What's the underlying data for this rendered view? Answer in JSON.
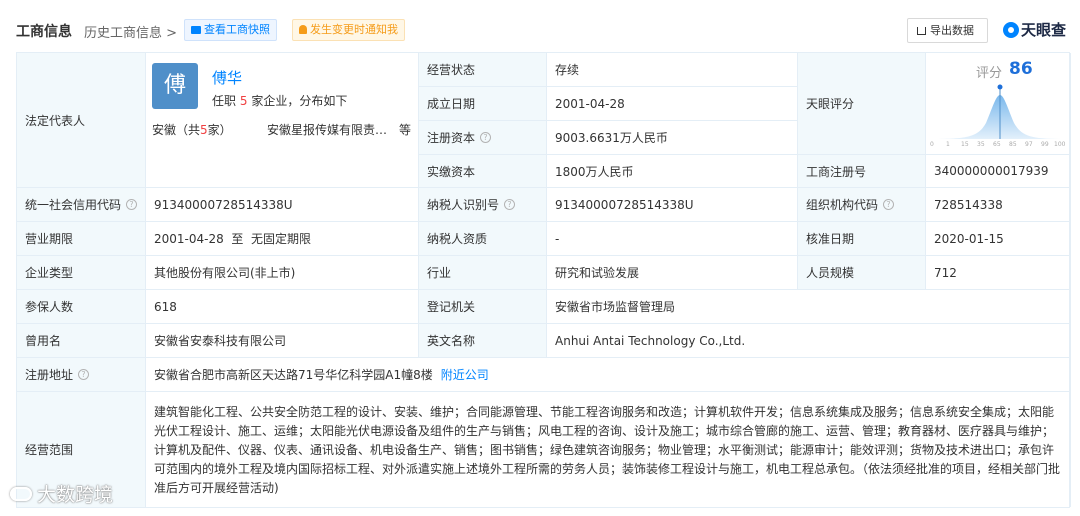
{
  "header": {
    "title": "工商信息",
    "history": "历史工商信息",
    "history_arrow": ">",
    "snapshot_button": "查看工商快照",
    "notify_button": "发生变更时通知我",
    "export_button": "导出数据",
    "logo": "天眼查"
  },
  "rep": {
    "label": "法定代表人",
    "avatar_char": "傅",
    "name": "傅华",
    "sub_prefix": "任职",
    "sub_count": "5",
    "sub_suffix": "家企业，分布如下",
    "prov_prefix": "安徽（共",
    "prov_count": "5",
    "prov_suffix": "家）",
    "company": "安徽星报传媒有限责…",
    "more": "等"
  },
  "rows": {
    "status_label": "经营状态",
    "status": "存续",
    "est_label": "成立日期",
    "est": "2001-04-28",
    "capital_label": "注册资本",
    "capital": "9003.6631万人民币",
    "paid_label": "实缴资本",
    "paid": "1800万人民币",
    "score_label": "天眼评分",
    "regno_label": "工商注册号",
    "regno": "340000000017939",
    "credit_label": "统一社会信用代码",
    "credit": "91340000728514338U",
    "taxid_label": "纳税人识别号",
    "taxid": "91340000728514338U",
    "org_label": "组织机构代码",
    "org": "728514338",
    "term_label": "营业期限",
    "term": "2001-04-28  至  无固定期限",
    "taxq_label": "纳税人资质",
    "taxq": "-",
    "approve_label": "核准日期",
    "approve": "2020-01-15",
    "type_label": "企业类型",
    "type": "其他股份有限公司(非上市)",
    "industry_label": "行业",
    "industry": "研究和试验发展",
    "staff_label": "人员规模",
    "staff": "712",
    "insured_label": "参保人数",
    "insured": "618",
    "authority_label": "登记机关",
    "authority": "安徽省市场监督管理局",
    "former_label": "曾用名",
    "former": "安徽省安泰科技有限公司",
    "en_label": "英文名称",
    "en": "Anhui Antai Technology Co.,Ltd.",
    "addr_label": "注册地址",
    "addr": "安徽省合肥市高新区天达路71号华亿科学园A1幢8楼",
    "addr_link": "附近公司",
    "scope_label": "经营范围",
    "scope": "建筑智能化工程、公共安全防范工程的设计、安装、维护；合同能源管理、节能工程咨询服务和改造；计算机软件开发；信息系统集成及服务；信息系统安全集成；太阳能光伏工程设计、施工、运维；太阳能光伏电源设备及组件的生产与销售；风电工程的咨询、设计及施工；城市综合管廊的施工、运营、管理；教育器材、医疗器具与维护；计算机及配件、仪器、仪表、通讯设备、机电设备生产、销售；图书销售；绿色建筑咨询服务；物业管理；水平衡测试；能源审计；能效评测；货物及技术进出口；承包许可范围内的境外工程及境内国际招标工程、对外派遣实施上述境外工程所需的劳务人员；装饰装修工程设计与施工，机电工程总承包。（依法须经批准的项目，经相关部门批准后方可开展经营活动)"
  },
  "score": {
    "label": "评分",
    "value": "86",
    "ticks": [
      "0",
      "1",
      "15",
      "35",
      "65",
      "85",
      "97",
      "99",
      "100"
    ]
  },
  "watermark": "大数跨境",
  "colors": {
    "accent": "#0084ff",
    "label_bg": "#f2f9fc",
    "border": "#e4eef6",
    "warn": "#f59c1a",
    "red": "#f04142"
  }
}
